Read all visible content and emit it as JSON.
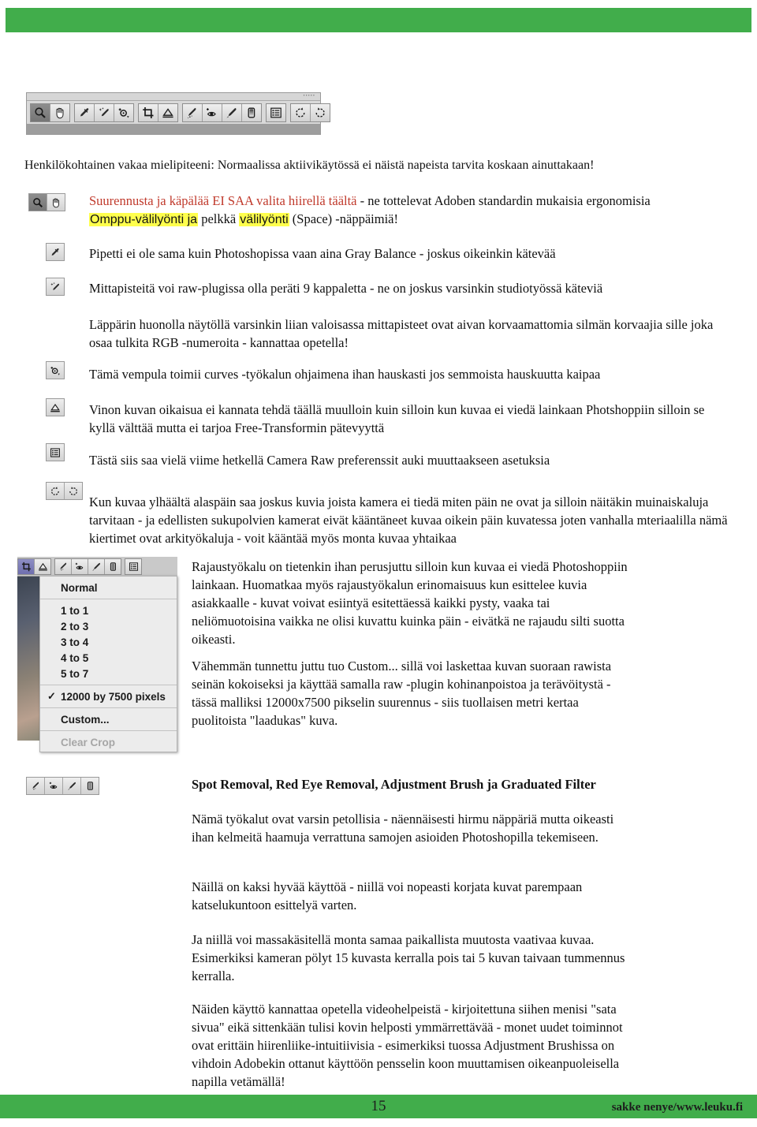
{
  "page": {
    "number": "15",
    "footer_credit": "sakke nenye/www.leuku.fi",
    "accent_green": "#41ad4b",
    "highlight_yellow": "#ffff4d",
    "red_text": "#c0392b"
  },
  "toolbar_top": {
    "name": "camera-raw-toolbar",
    "title_dots": "•••••",
    "buttons": [
      {
        "icon": "zoom-icon",
        "selected": true
      },
      {
        "icon": "hand-icon",
        "selected": false
      },
      {
        "icon": "white-balance-eyedropper-icon",
        "selected": false
      },
      {
        "icon": "color-sampler-eyedropper-icon",
        "selected": false
      },
      {
        "icon": "targeted-adjustment-icon",
        "selected": false
      },
      {
        "icon": "crop-icon",
        "selected": false
      },
      {
        "icon": "straighten-icon",
        "selected": false
      },
      {
        "icon": "spot-removal-icon",
        "selected": false
      },
      {
        "icon": "red-eye-removal-icon",
        "selected": false
      },
      {
        "icon": "adjustment-brush-icon",
        "selected": false
      },
      {
        "icon": "graduated-filter-icon",
        "selected": false
      },
      {
        "icon": "preferences-icon",
        "selected": false
      },
      {
        "icon": "rotate-left-icon",
        "selected": false
      },
      {
        "icon": "rotate-right-icon",
        "selected": false
      }
    ]
  },
  "body": {
    "intro": "Henkilökohtainen vakaa mielipiteeni: Normaalissa aktiivikäytössä ei näistä napeista tarvita koskaan ainuttakaan!",
    "zoom_hand": {
      "red_part": "Suurennusta ja käpälää EI SAA valita hiirellä täältä",
      "rest_line1": " - ne tottelevat Adoben standardin mukaisia ergonomisia",
      "hl1": "Omppu-välilyönti ja",
      "mid": " pelkkä ",
      "hl2": "välilyönti",
      "tail": " (Space)  -näppäimiä!"
    },
    "eyedropper": "Pipetti ei ole sama kuin Photoshopissa vaan aina Gray Balance - joskus oikeinkin kätevää",
    "sampler": "Mittapisteitä voi raw-plugissa olla peräti 9 kappaletta - ne on joskus varsinkin studiotyössä käteviä",
    "sampler_note": "Läppärin huonolla näytöllä varsinkin liian valoisassa mittapisteet ovat aivan korvaamattomia silmän korvaajia sille joka osaa tulkita RGB -numeroita - kannattaa opetella!",
    "targeted": "Tämä vempula toimii curves -työkalun ohjaimena ihan hauskasti jos semmoista hauskuutta kaipaa",
    "straighten": "Vinon kuvan oikaisua ei kannata tehdä täällä muulloin kuin silloin kun kuvaa ei viedä lainkaan Photshoppiin silloin se kyllä välttää mutta ei tarjoa Free-Transformin pätevyyttä",
    "preferences": "Tästä siis saa vielä viime hetkellä Camera Raw preferenssit auki muuttaakseen asetuksia",
    "rotate": "Kun kuvaa ylhäältä alaspäin saa joskus kuvia joista kamera ei tiedä miten päin ne ovat ja silloin näitäkin muinaiskaluja tarvitaan - ja edellisten sukupolvien kamerat eivät kääntäneet kuvaa oikein päin kuvatessa joten vanhalla mteriaalilla nämä kiertimet ovat arkityökaluja - voit kääntää myös monta kuvaa yhtaikaa",
    "crop_para1": "Rajaustyökalu on tietenkin ihan perusjuttu silloin kun kuvaa ei viedä Photoshoppiin lainkaan. Huomatkaa myös rajaustyökalun erinomaisuus kun esittelee kuvia asiakkaalle - kuvat voivat esiintyä esitettäessä kaikki pysty, vaaka tai neliömuotoisina vaikka ne olisi kuvattu kuinka päin - eivätkä ne rajaudu silti suotta oikeasti.",
    "crop_para2": "Vähemmän tunnettu juttu tuo Custom... sillä voi laskettaa kuvan suoraan rawista seinän kokoiseksi ja käyttää samalla raw -plugin kohinanpoistoa ja terävöitystä - tässä malliksi 12000x7500 pikselin suurennus - siis tuollaisen metri kertaa puolitoista \"laadukas\" kuva.",
    "section_heading": "Spot Removal, Red Eye Removal, Adjustment Brush ja Graduated Filter",
    "sec_para1": "Nämä työkalut ovat varsin petollisia - näennäisesti hirmu näppäriä mutta oikeasti ihan kelmeitä haamuja verrattuna samojen asioiden Photoshopilla tekemiseen.",
    "sec_para2": "Näillä on kaksi hyvää käyttöä - niillä voi nopeasti korjata kuvat parempaan katselukuntoon esittelyä varten.",
    "sec_para3": "Ja niillä voi massakäsitellä monta samaa paikallista muutosta vaativaa kuvaa. Esimerkiksi kameran pölyt 15 kuvasta kerralla pois tai 5 kuvan taivaan tummennus kerralla.",
    "sec_para4": "Näiden käyttö kannattaa opetella videohelpeistä - kirjoitettuna siihen menisi \"sata sivua\" eikä sittenkään tulisi kovin helposti ymmärrettävää - monet uudet toiminnot ovat erittäin hiirenliike-intuitiivisia - esimerkiksi tuossa Adjustment Brushissa on vihdoin Adobekin ottanut käyttöön pensselin koon muuttamisen oikeanpuoleisella napilla vetämällä!"
  },
  "crop_menu": {
    "name": "crop-aspect-ratio-menu",
    "items": [
      {
        "label": "Normal",
        "checked": false,
        "disabled": false
      },
      {
        "label": "1 to 1",
        "checked": false,
        "disabled": false
      },
      {
        "label": "2 to 3",
        "checked": false,
        "disabled": false
      },
      {
        "label": "3 to 4",
        "checked": false,
        "disabled": false
      },
      {
        "label": "4 to 5",
        "checked": false,
        "disabled": false
      },
      {
        "label": "5 to 7",
        "checked": false,
        "disabled": false
      },
      {
        "label": "12000 by 7500 pixels",
        "checked": true,
        "disabled": false
      },
      {
        "label": "Custom...",
        "checked": false,
        "disabled": false
      },
      {
        "label": "Clear Crop",
        "checked": false,
        "disabled": true
      }
    ],
    "check_glyph": "✓"
  }
}
